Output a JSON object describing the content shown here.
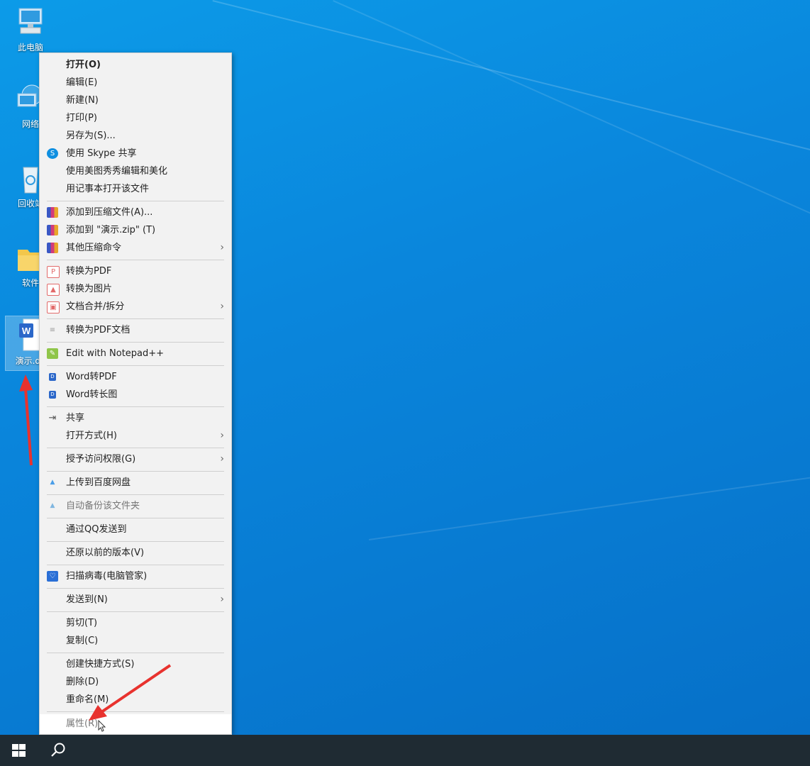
{
  "desktop": {
    "icons": [
      {
        "label": "此电脑",
        "icon": "computer-icon"
      },
      {
        "label": "网络",
        "icon": "network-icon"
      },
      {
        "label": "回收站",
        "icon": "recycle-bin-icon"
      },
      {
        "label": "软件",
        "icon": "folder-icon"
      },
      {
        "label": "演示.do",
        "icon": "word-doc-icon"
      }
    ]
  },
  "menu": {
    "items": [
      {
        "label": "打开(O)"
      },
      {
        "label": "编辑(E)"
      },
      {
        "label": "新建(N)"
      },
      {
        "label": "打印(P)"
      },
      {
        "label": "另存为(S)..."
      },
      {
        "label": "使用 Skype 共享",
        "icon": "skype-icon"
      },
      {
        "label": "使用美图秀秀编辑和美化"
      },
      {
        "label": "用记事本打开该文件"
      },
      {
        "label": "添加到压缩文件(A)...",
        "icon": "winrar-icon"
      },
      {
        "label": "添加到 \"演示.zip\" (T)",
        "icon": "winrar-icon"
      },
      {
        "label": "其他压缩命令",
        "icon": "winrar-icon"
      },
      {
        "label": "转换为PDF",
        "icon": "pdf-convert-icon"
      },
      {
        "label": "转换为图片",
        "icon": "image-convert-icon"
      },
      {
        "label": "文档合并/拆分",
        "icon": "merge-split-icon"
      },
      {
        "label": "转换为PDF文档",
        "icon": "pdf-doc-icon"
      },
      {
        "label": "Edit with Notepad++",
        "icon": "notepadpp-icon"
      },
      {
        "label": "Word转PDF",
        "icon": "word-pdf-icon"
      },
      {
        "label": "Word转长图",
        "icon": "word-image-icon"
      },
      {
        "label": "共享",
        "icon": "share-icon"
      },
      {
        "label": "打开方式(H)"
      },
      {
        "label": "授予访问权限(G)"
      },
      {
        "label": "上传到百度网盘",
        "icon": "baidu-cloud-icon"
      },
      {
        "label": "自动备份该文件夹",
        "icon": "baidu-backup-icon"
      },
      {
        "label": "通过QQ发送到"
      },
      {
        "label": "还原以前的版本(V)"
      },
      {
        "label": "扫描病毒(电脑管家)",
        "icon": "shield-icon"
      },
      {
        "label": "发送到(N)"
      },
      {
        "label": "剪切(T)"
      },
      {
        "label": "复制(C)"
      },
      {
        "label": "创建快捷方式(S)"
      },
      {
        "label": "删除(D)"
      },
      {
        "label": "重命名(M)"
      },
      {
        "label": "属性(R)"
      }
    ]
  },
  "taskbar": {
    "start_icon": "windows-start-icon",
    "search_icon": "search-icon"
  },
  "colors": {
    "desktop": "#0a86dc",
    "menu_bg": "#f2f2f2",
    "taskbar": "#1f2b33",
    "annotation_arrow": "#e8322e"
  }
}
